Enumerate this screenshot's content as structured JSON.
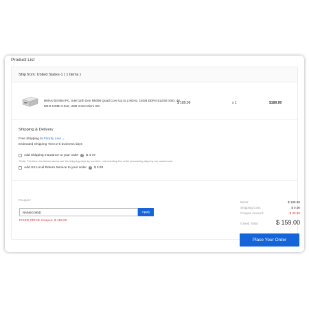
{
  "product_list": {
    "title": "Product List",
    "ship_from": "Ship from: United States-1 ( 1 Items )",
    "item": {
      "name": "BMAX B3 Mini PC, Intel 11th Gen N5095 Quad Core Up to 2.9GHz, 16GB DDR4 512GB SSD, 4K 60Hz HDMI 2.0x2, USB 3.0x4 Micro SD.",
      "price": "$ 189.99",
      "qty": "x 1",
      "subtotal": "$189.99"
    }
  },
  "shipping": {
    "title": "Shipping & Delivery",
    "free_prefix": "Free Shipping",
    "to": " to ",
    "method": "Priority Line",
    "chevron": "⌄",
    "estimate": "Estimated Shipping Time:2-5 business days",
    "insurance_label": "Add Shipping Insurance to your order",
    "insurance_price": "$ 4.79",
    "note": "*Note: The time mentioned above are the shipping days by couriers, not including the order processing days by our warehouse.",
    "return_label": "Add US Local Return Service to your order",
    "return_price": "$ 3.80",
    "icon_char": "?"
  },
  "coupon": {
    "label": "Coupon:",
    "code": "NNN6G085D",
    "apply_label": "Apply",
    "message": "FIXED PRICE Coupon: $ 159.00"
  },
  "summary": {
    "items_label": "Items:",
    "items_value": "$ 189.99",
    "shipping_label": "Shipping Cost:",
    "shipping_value": "$ 0.00",
    "coupon_label": "Coupon Amount:",
    "coupon_value": "- $ 30.99",
    "grand_label": "Grand Total:",
    "grand_value": "$ 159.00",
    "place_order": "Place Your Order"
  },
  "colors": {
    "accent": "#1565d8",
    "discount": "#e53935",
    "link": "#1a73e8"
  }
}
